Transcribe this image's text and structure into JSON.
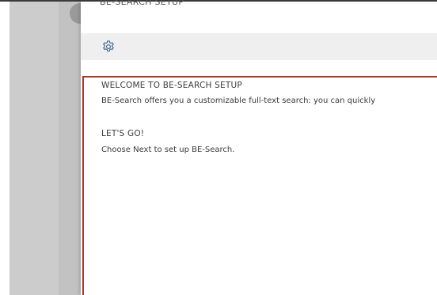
{
  "window": {
    "title": "BE-SEARCH SETUP"
  },
  "toolbar": {
    "icon": "gear-icon"
  },
  "wizard": {
    "welcome_heading": "WELCOME TO BE-SEARCH SETUP",
    "welcome_text": "BE-Search offers you a customizable full-text search: you can quickly",
    "letsgo_heading": "LET'S GO!",
    "letsgo_text": "Choose Next to set up BE-Search."
  },
  "colors": {
    "accent_border": "#a53a2a",
    "toolbar_bg": "#efefef",
    "backdrop": "#cccccc"
  }
}
